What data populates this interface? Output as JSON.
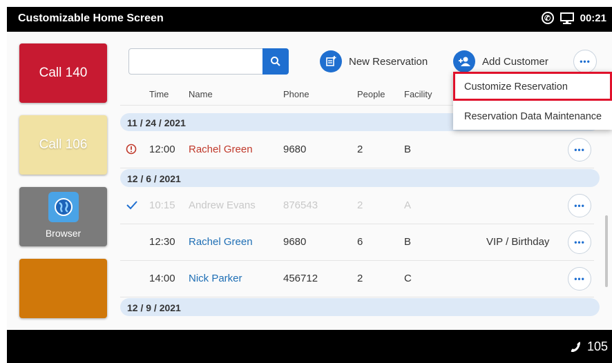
{
  "statusbar": {
    "title": "Customizable Home Screen",
    "time": "00:21"
  },
  "bottombar": {
    "extension": "105"
  },
  "tiles": [
    {
      "label": "Call 140"
    },
    {
      "label": "Call 106"
    },
    {
      "label": "Browser"
    },
    {
      "label": ""
    }
  ],
  "search": {
    "value": "",
    "placeholder": ""
  },
  "actions": {
    "new_reservation": "New Reservation",
    "add_customer": "Add Customer"
  },
  "columns": {
    "time": "Time",
    "name": "Name",
    "phone": "Phone",
    "people": "People",
    "facility": "Facility"
  },
  "menu": {
    "item1": "Customize Reservation",
    "item2": "Reservation Data Maintenance"
  },
  "groups": [
    {
      "date": "11 / 24 / 2021",
      "rows": [
        {
          "time": "12:00",
          "name": "Rachel Green",
          "phone": "9680",
          "people": "2",
          "facility": "B",
          "note": ""
        }
      ]
    },
    {
      "date": "12 / 6 / 2021",
      "rows": [
        {
          "time": "10:15",
          "name": "Andrew Evans",
          "phone": "876543",
          "people": "2",
          "facility": "A",
          "note": ""
        },
        {
          "time": "12:30",
          "name": "Rachel Green",
          "phone": "9680",
          "people": "6",
          "facility": "B",
          "note": "VIP / Birthday"
        },
        {
          "time": "14:00",
          "name": "Nick Parker",
          "phone": "456712",
          "people": "2",
          "facility": "C",
          "note": ""
        }
      ]
    },
    {
      "date": "12 / 9 / 2021",
      "rows": []
    }
  ],
  "more_label": "•••",
  "colors": {
    "accent": "#1f6fd0",
    "highlight": "#e0112b",
    "group_bg": "#dde9f7"
  }
}
